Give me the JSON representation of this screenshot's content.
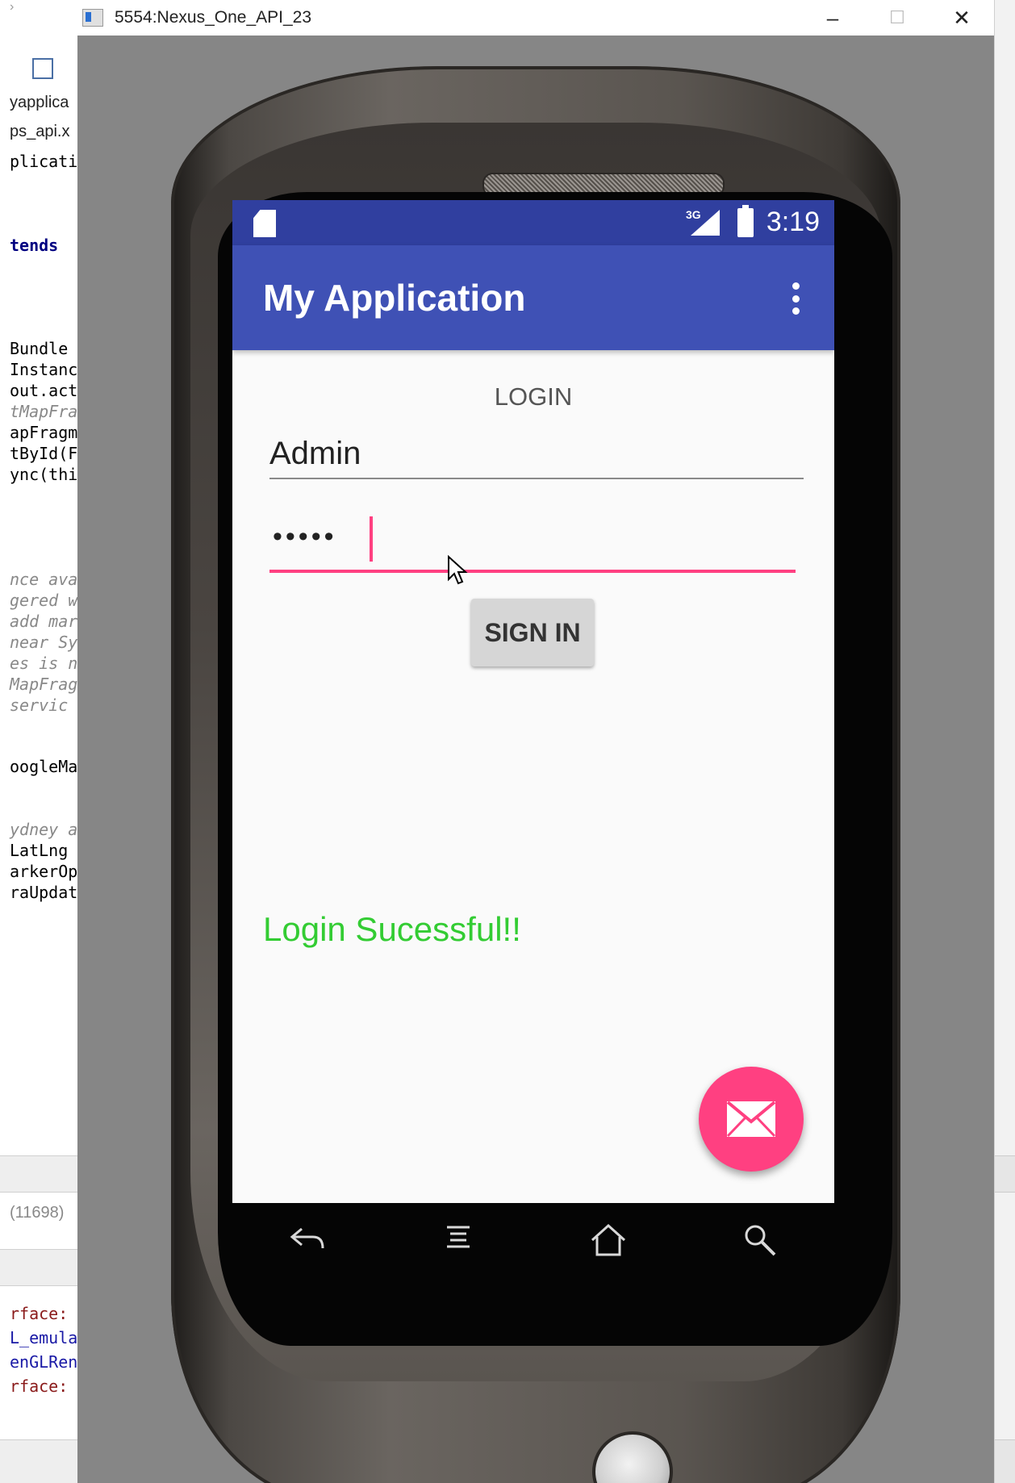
{
  "ide": {
    "left_lines": [
      {
        "text": "yapplica",
        "style": "sans"
      },
      {
        "text": "ps_api.x",
        "style": "sans"
      },
      {
        "text": "plicati",
        "style": "mono"
      },
      {
        "text": "tends",
        "style": "mono-kw"
      },
      {
        "text": "Bundle",
        "style": "mono"
      },
      {
        "text": "Instanc",
        "style": "mono"
      },
      {
        "text": "out.act",
        "style": "mono"
      },
      {
        "text": "tMapFra",
        "style": "mono-italic"
      },
      {
        "text": "apFragm",
        "style": "mono"
      },
      {
        "text": "tById(F",
        "style": "mono"
      },
      {
        "text": "ync(thi",
        "style": "mono"
      },
      {
        "text": "nce ava",
        "style": "mono-italic"
      },
      {
        "text": "gered w",
        "style": "mono-italic"
      },
      {
        "text": "add mar",
        "style": "mono-italic"
      },
      {
        "text": "near Sy",
        "style": "mono-italic"
      },
      {
        "text": "es is n",
        "style": "mono-italic"
      },
      {
        "text": "MapFrag",
        "style": "mono-italic"
      },
      {
        "text": "servic",
        "style": "mono-italic"
      },
      {
        "text": "oogleMa",
        "style": "mono"
      },
      {
        "text": "ydney a",
        "style": "mono-italic"
      },
      {
        "text": "LatLng",
        "style": "mono"
      },
      {
        "text": "arkerOp",
        "style": "mono"
      },
      {
        "text": "raUpdat",
        "style": "mono"
      },
      {
        "text": "(11698)",
        "style": "sans-gray"
      },
      {
        "text": "rface:",
        "style": "mono-red"
      },
      {
        "text": "L_emula",
        "style": "mono-blue"
      },
      {
        "text": "enGLRen",
        "style": "mono-blue"
      },
      {
        "text": "rface:",
        "style": "mono-red"
      }
    ]
  },
  "emulator": {
    "title": "5554:Nexus_One_API_23",
    "minimize": "–",
    "maximize": "☐",
    "close": "✕"
  },
  "status_bar": {
    "network": "3G",
    "time": "3:19"
  },
  "app_bar": {
    "title": "My Application",
    "overflow_icon": "more-vert-icon"
  },
  "login": {
    "heading": "LOGIN",
    "username_value": "Admin",
    "password_dots": "•••••",
    "sign_in_label": "SIGN IN",
    "result_message": "Login Sucessful!!"
  },
  "fab": {
    "icon": "mail-icon"
  },
  "colors": {
    "status_bar": "#303f9f",
    "app_bar": "#3f51b5",
    "accent": "#ff4081",
    "success_text": "#33cc33"
  }
}
